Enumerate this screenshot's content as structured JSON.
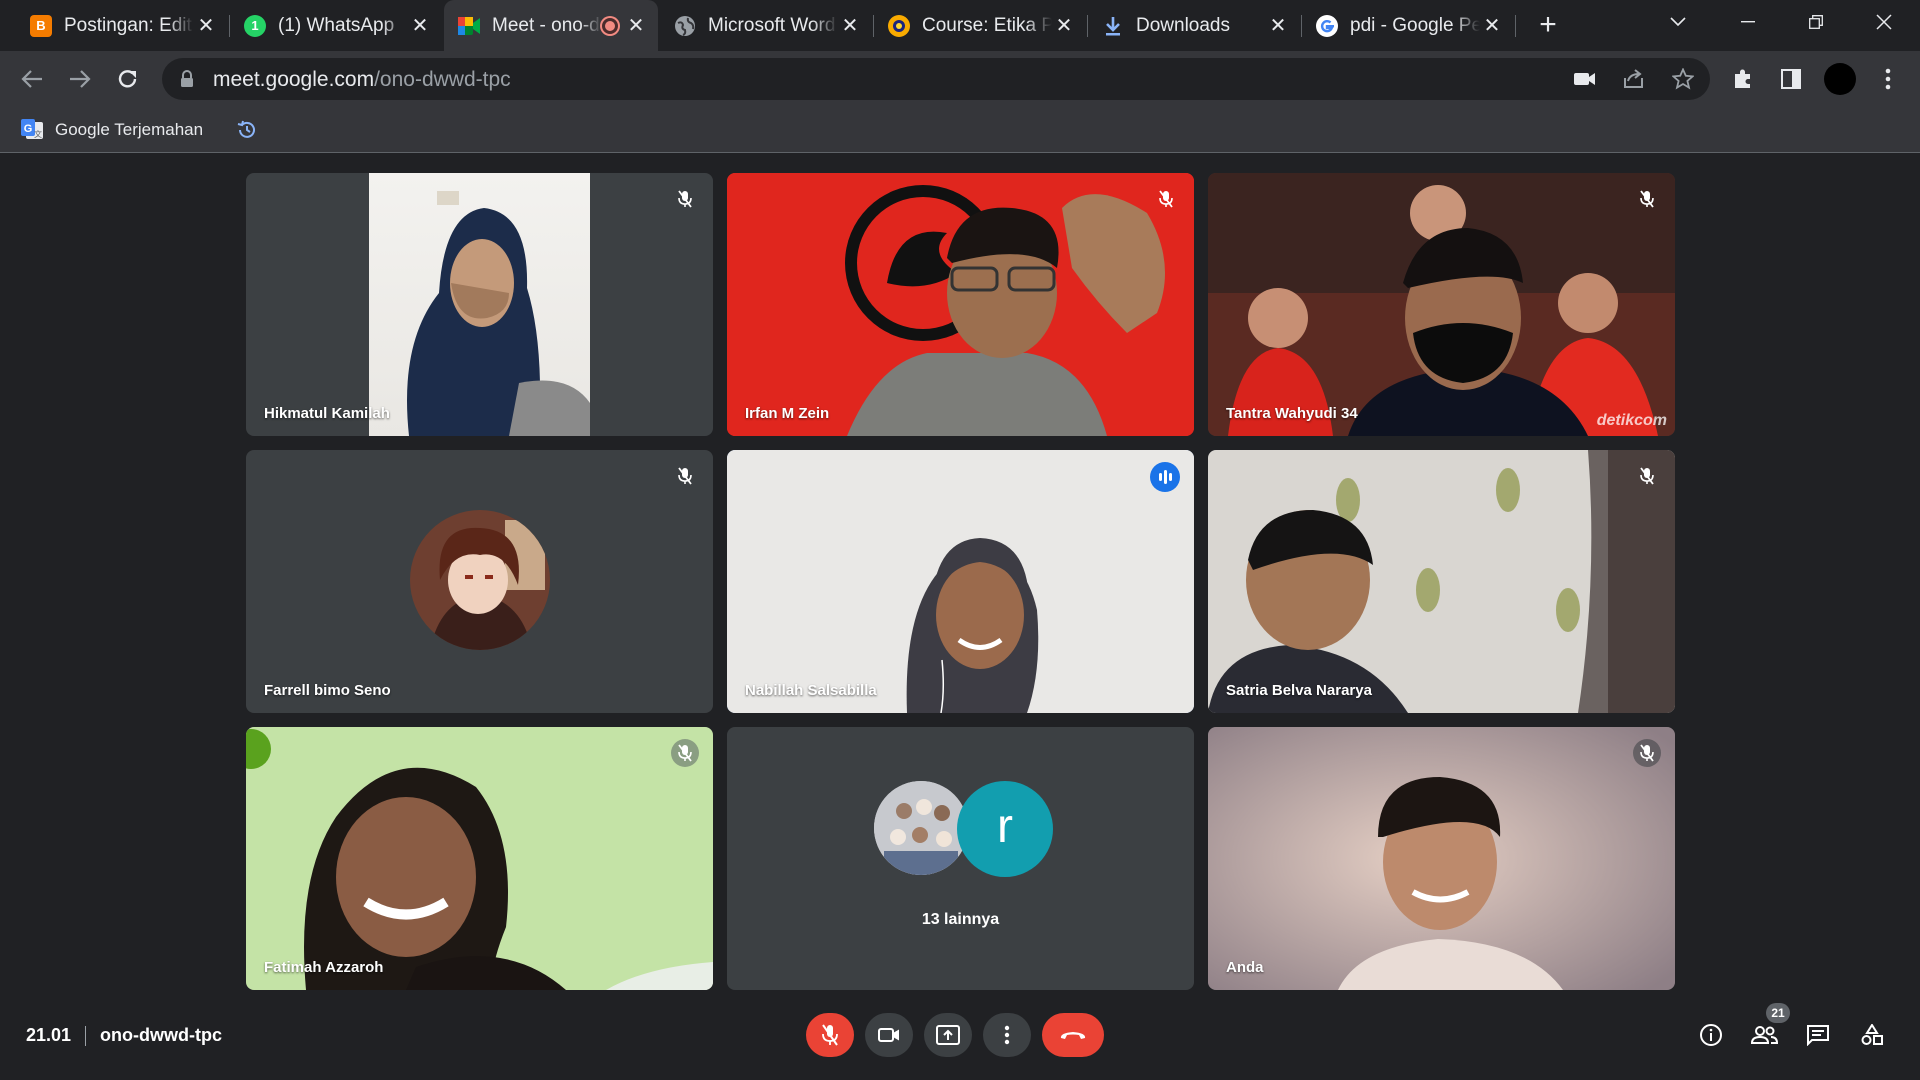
{
  "browser": {
    "tabs": [
      {
        "title": "Postingan: Edit",
        "icon": "blogger-icon",
        "color": "#f57c00"
      },
      {
        "title": "(1) WhatsApp",
        "icon": "whatsapp-icon",
        "color": "#25d366"
      },
      {
        "title": "Meet - ono-dwwd-tpc",
        "icon": "google-meet-icon",
        "color": "#00832d",
        "active": true
      },
      {
        "title": "Microsoft Word",
        "icon": "globe-icon",
        "color": "#9aa0a6"
      },
      {
        "title": "Course: Etika Pe",
        "icon": "university-logo-icon",
        "color": "#f9ab00"
      },
      {
        "title": "Downloads",
        "icon": "download-icon",
        "color": "#8ab4f8"
      },
      {
        "title": "pdi - Google Pe",
        "icon": "google-icon",
        "color": "#4285f4"
      }
    ],
    "url_host": "meet.google.com",
    "url_path": "/ono-dwwd-tpc",
    "bookmarks": [
      {
        "label": "Google Terjemahan",
        "icon": "google-translate-icon"
      }
    ]
  },
  "meet": {
    "participants": [
      {
        "name": "Hikmatul Kamilah",
        "muted": true
      },
      {
        "name": "Irfan M Zein",
        "muted": true
      },
      {
        "name": "Tantra Wahyudi 34",
        "muted": true
      },
      {
        "name": "Farrell bimo Seno",
        "muted": true
      },
      {
        "name": "Nabillah Salsabilla",
        "muted": false,
        "speaking": true
      },
      {
        "name": "Satria Belva Nararya",
        "muted": true
      },
      {
        "name": "Fatimah Azzaroh",
        "muted": true
      },
      {
        "name": "Anda",
        "muted": true
      }
    ],
    "others": {
      "label": "13 lainnya",
      "avatar_letter": "r",
      "avatar_color": "#129eaf"
    },
    "watermark": "detikcom",
    "time": "21.01",
    "meeting_code": "ono-dwwd-tpc",
    "participant_count": "21",
    "colors": {
      "end_call": "#ea4335",
      "accent": "#8ab4f8",
      "speaking": "#1a73e8"
    }
  }
}
